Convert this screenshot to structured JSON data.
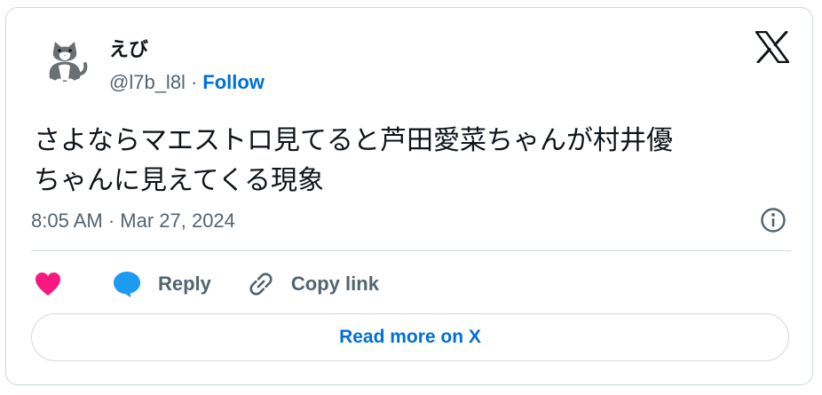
{
  "author": {
    "display_name": "えび",
    "handle": "@l7b_l8l",
    "separator": "·",
    "follow_label": "Follow",
    "avatar_icon": "cat-avatar-icon"
  },
  "brand": {
    "logo_icon": "x-logo-icon"
  },
  "tweet": {
    "text": "さよならマエストロ見てると芦田愛菜ちゃんが村井優\nちゃんに見えてくる現象",
    "timestamp": "8:05 AM · Mar 27, 2024"
  },
  "actions": {
    "like_icon": "heart-icon",
    "reply_icon": "speech-bubble-icon",
    "reply_label": "Reply",
    "copy_icon": "link-icon",
    "copy_label": "Copy link"
  },
  "footer": {
    "read_more_label": "Read more on X"
  },
  "colors": {
    "accent": "#006fd6",
    "muted_text": "#536471",
    "border": "#cfd9de",
    "like": "#f91880",
    "reply": "#1d9bf0"
  }
}
